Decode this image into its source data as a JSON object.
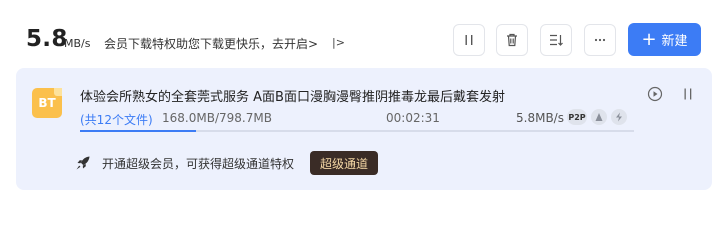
{
  "header": {
    "speed_value": "5.8",
    "speed_unit": "MB/s",
    "promo_text": "会员下载特权助您下载更快乐，去开启>",
    "promo_more": "|>",
    "new_button_label": "新建"
  },
  "task": {
    "icon_label": "BT",
    "name": "体验会所熟女的全套莞式服务 A面B面口漫胸漫臀推阴推毒龙最后戴套发射",
    "files": "(共12个文件)",
    "size": "168.0MB/798.7MB",
    "remaining_time": "00:02:31",
    "speed": "5.8MB/s",
    "badge_p2p": "P2P",
    "progress": 0.21
  },
  "vip": {
    "text": "开通超级会员，可获得超级通道特权",
    "button_label": "超级通道"
  },
  "colors": {
    "accent": "#3c7cf5",
    "card_bg": "#edf1fd",
    "bt_icon": "#fbc04c",
    "vip_button_bg": "#3a2c26",
    "vip_button_text": "#f3d6a4"
  }
}
